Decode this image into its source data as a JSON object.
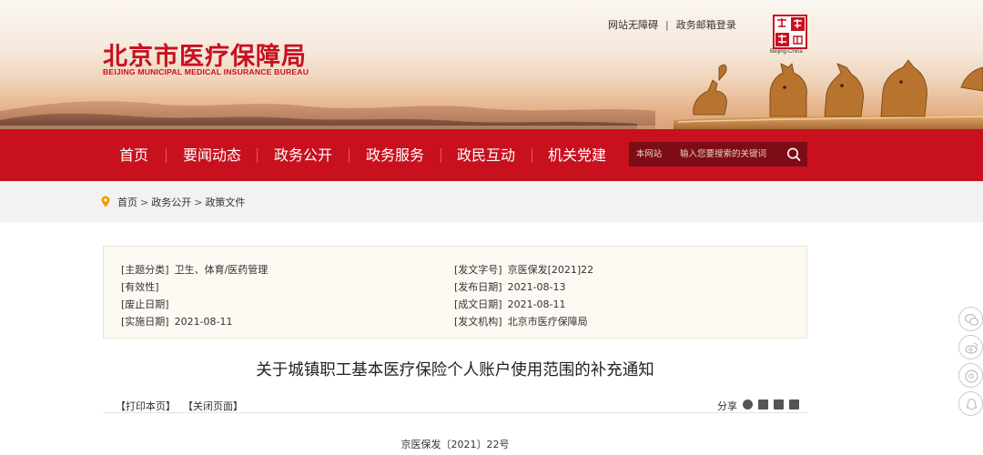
{
  "site": {
    "name_cn": "北京市医疗保障局",
    "name_en": "BEIJING MUNICIPAL MEDICAL INSURANCE BUREAU",
    "top_links": [
      "网站无障碍",
      "政务邮箱登录"
    ],
    "seal_sub": "Beijing-China",
    "brand_color": "#c8101f"
  },
  "nav": {
    "items": [
      "首页",
      "要闻动态",
      "政务公开",
      "政务服务",
      "政民互动",
      "机关党建"
    ],
    "search": {
      "scope": "本网站",
      "placeholder": "输入您要搜索的关键词",
      "icon": "search-icon"
    }
  },
  "breadcrumb": [
    "首页",
    "政务公开",
    "政策文件"
  ],
  "meta": {
    "left": [
      {
        "label": "[主题分类]",
        "value": "卫生、体育/医药管理"
      },
      {
        "label": "[有效性]",
        "value": ""
      },
      {
        "label": "[废止日期]",
        "value": ""
      },
      {
        "label": "[实施日期]",
        "value": "2021-08-11"
      }
    ],
    "right": [
      {
        "label": "[发文字号]",
        "value": "京医保发[2021]22"
      },
      {
        "label": "[发布日期]",
        "value": "2021-08-13"
      },
      {
        "label": "[成文日期]",
        "value": "2021-08-11"
      },
      {
        "label": "[发文机构]",
        "value": "北京市医疗保障局"
      }
    ]
  },
  "article": {
    "title": "关于城镇职工基本医疗保险个人账户使用范围的补充通知",
    "print_label": "【打印本页】",
    "close_label": "【关闭页面】",
    "share_label": "分享",
    "doc_number": "京医保发〔2021〕22号"
  },
  "side_icons": [
    "wechat-icon",
    "weibo-icon",
    "mini-program-icon",
    "qq-icon"
  ]
}
